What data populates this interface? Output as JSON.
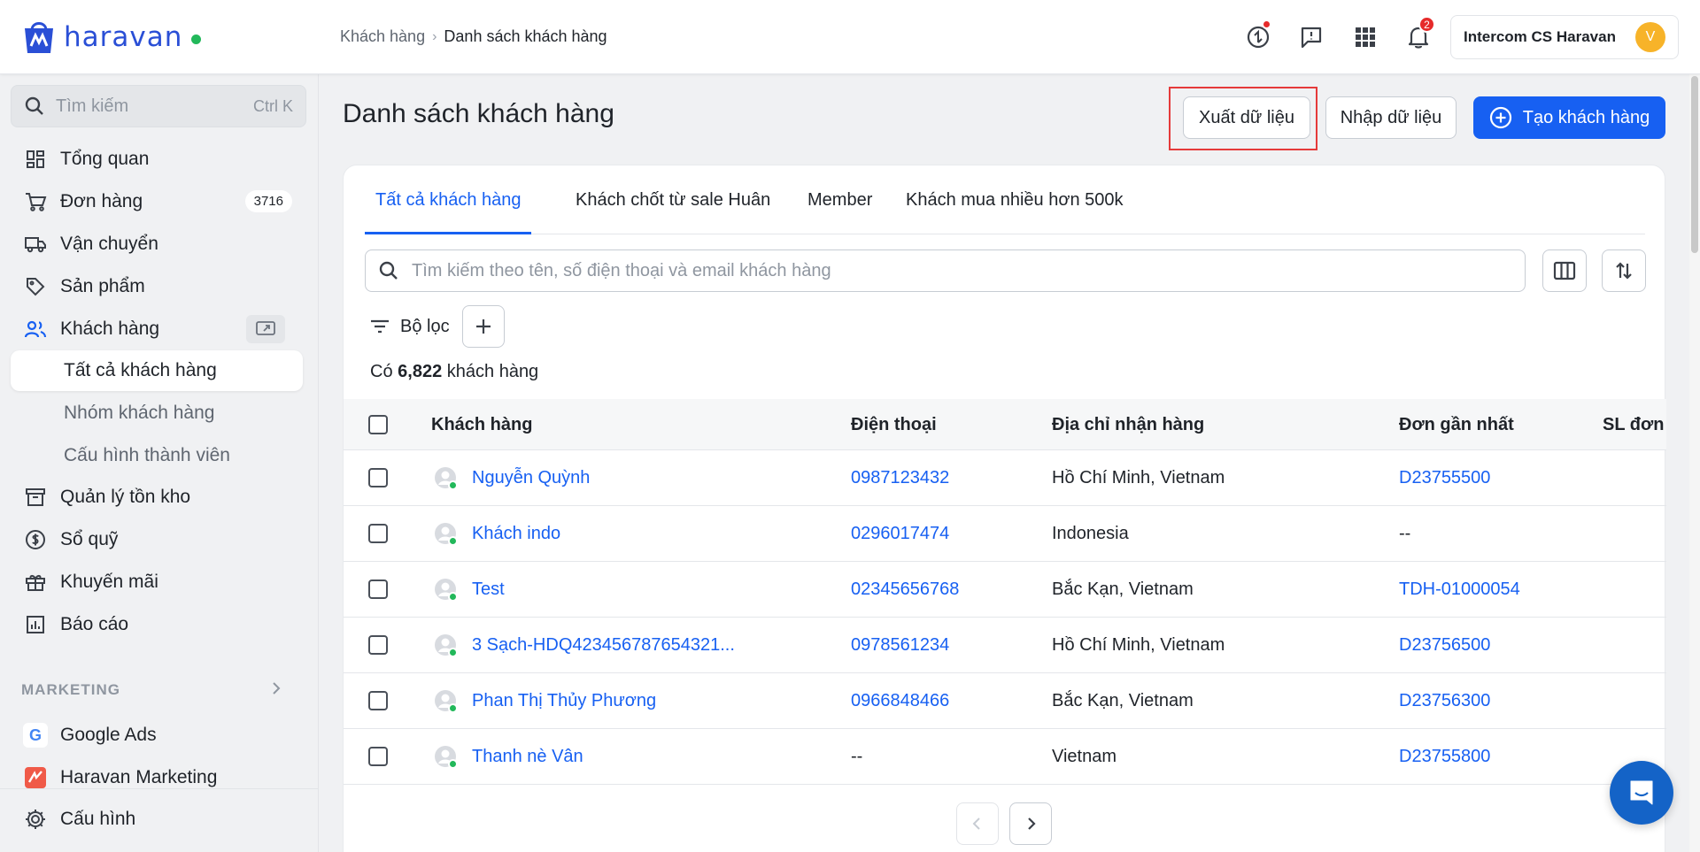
{
  "brand": {
    "name": "haravan"
  },
  "breadcrumb": {
    "parent": "Khách hàng",
    "current": "Danh sách khách hàng"
  },
  "header": {
    "account_name": "Intercom CS Haravan",
    "avatar_letter": "V",
    "notification_count": "2"
  },
  "sidebar": {
    "search_placeholder": "Tìm kiếm",
    "search_shortcut": "Ctrl K",
    "items": [
      {
        "label": "Tổng quan",
        "icon": "dashboard-icon"
      },
      {
        "label": "Đơn hàng",
        "icon": "cart-icon",
        "count": "3716"
      },
      {
        "label": "Vận chuyển",
        "icon": "truck-icon"
      },
      {
        "label": "Sản phẩm",
        "icon": "tag-icon"
      },
      {
        "label": "Khách hàng",
        "icon": "users-icon"
      },
      {
        "label": "Quản lý tồn kho",
        "icon": "archive-icon"
      },
      {
        "label": "Sổ quỹ",
        "icon": "dollar-icon"
      },
      {
        "label": "Khuyến mãi",
        "icon": "gift-icon"
      },
      {
        "label": "Báo cáo",
        "icon": "report-icon"
      }
    ],
    "customer_sub": [
      "Tất cả khách hàng",
      "Nhóm khách hàng",
      "Cấu hình thành viên"
    ],
    "marketing_label": "MARKETING",
    "marketing_items": [
      {
        "label": "Google Ads",
        "icon": "google-icon"
      },
      {
        "label": "Haravan Marketing",
        "icon": "haravan-marketing-icon"
      }
    ],
    "settings_label": "Cấu hình"
  },
  "page": {
    "title": "Danh sách khách hàng",
    "export_label": "Xuất dữ liệu",
    "import_label": "Nhập dữ liệu",
    "create_label": "Tạo khách hàng"
  },
  "tabs": [
    "Tất cả khách hàng",
    "Khách chốt từ sale Huân",
    "Member",
    "Khách mua nhiều hơn 500k"
  ],
  "search": {
    "placeholder": "Tìm kiếm theo tên, số điện thoại và email khách hàng"
  },
  "filter": {
    "label": "Bộ lọc"
  },
  "summary": {
    "prefix": "Có",
    "count": "6,822",
    "suffix": "khách hàng"
  },
  "table": {
    "columns": [
      "Khách hàng",
      "Điện thoại",
      "Địa chỉ nhận hàng",
      "Đơn gần nhất",
      "SL đơn"
    ],
    "rows": [
      {
        "name": "Nguyễn Quỳnh",
        "phone": "0987123432",
        "address": "Hồ Chí Minh, Vietnam",
        "last_order": "D23755500"
      },
      {
        "name": "Khách indo",
        "phone": "0296017474",
        "address": "Indonesia",
        "last_order": "--"
      },
      {
        "name": "Test",
        "phone": "02345656768",
        "address": "Bắc Kạn, Vietnam",
        "last_order": "TDH-01000054"
      },
      {
        "name": "3 Sạch-HDQ423456787654321...",
        "phone": "0978561234",
        "address": "Hồ Chí Minh, Vietnam",
        "last_order": "D23756500"
      },
      {
        "name": "Phan Thị Thủy Phương",
        "phone": "0966848466",
        "address": "Bắc Kạn, Vietnam",
        "last_order": "D23756300"
      },
      {
        "name": "Thanh nè Vân",
        "phone": "--",
        "address": "Vietnam",
        "last_order": "D23755800"
      }
    ]
  },
  "colors": {
    "primary": "#1760f2",
    "brand": "#2a4fd6",
    "highlight": "#e53a3a",
    "online": "#22b85a"
  }
}
